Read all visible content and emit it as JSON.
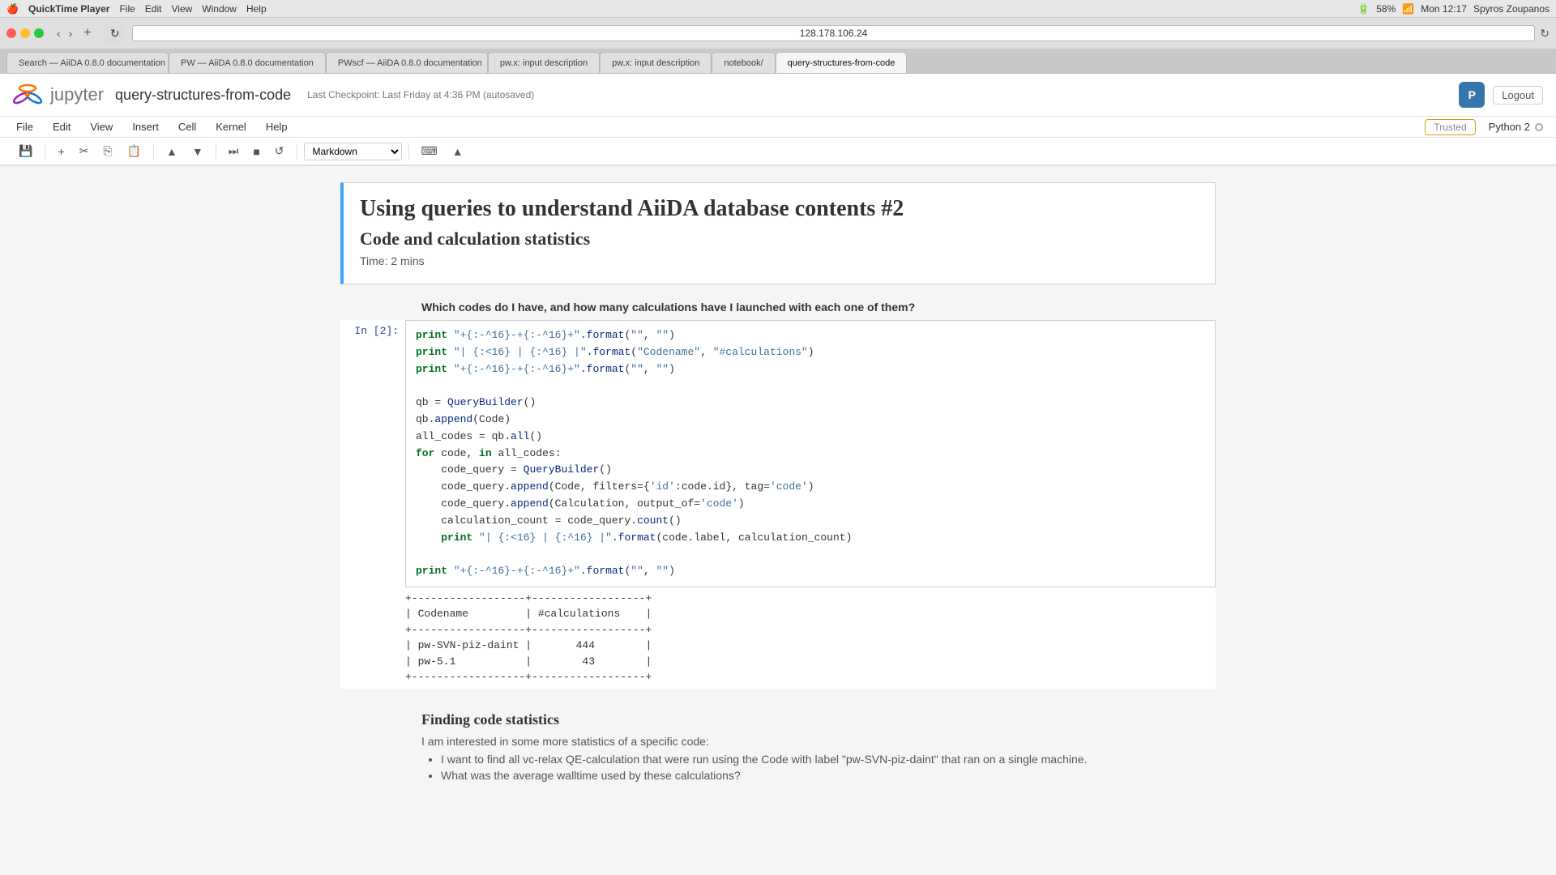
{
  "macbar": {
    "apple": "🍎",
    "app_name": "QuickTime Player",
    "menus": [
      "File",
      "Edit",
      "View",
      "Window",
      "Help"
    ],
    "time": "Mon 12:17",
    "user": "Spyros Zoupanos",
    "battery": "58%"
  },
  "browser": {
    "address": "128.178.106.24",
    "tabs": [
      {
        "id": "tab1",
        "label": "Search — AiiDA 0.8.0 documentation",
        "active": false
      },
      {
        "id": "tab2",
        "label": "PW — AiiDA 0.8.0 documentation",
        "active": false
      },
      {
        "id": "tab3",
        "label": "PWscf — AiiDA 0.8.0 documentation",
        "active": false
      },
      {
        "id": "tab4",
        "label": "pw.x: input description",
        "active": false
      },
      {
        "id": "tab5",
        "label": "pw.x: input description",
        "active": false
      },
      {
        "id": "tab6",
        "label": "notebook/",
        "active": false
      },
      {
        "id": "tab7",
        "label": "query-structures-from-code",
        "active": true
      }
    ]
  },
  "jupyter": {
    "notebook_name": "query-structures-from-code",
    "checkpoint": "Last Checkpoint: Last Friday at 4:36 PM (autosaved)",
    "logout_label": "Logout",
    "trusted_label": "Trusted",
    "kernel_name": "Python 2",
    "menus": [
      "File",
      "Edit",
      "View",
      "Insert",
      "Cell",
      "Kernel",
      "Help"
    ],
    "cell_type": "Markdown",
    "toolbar_buttons": {
      "save": "💾",
      "add": "+",
      "cut": "✂",
      "copy": "⎘",
      "paste": "📋",
      "move_up": "▲",
      "move_down": "▼",
      "step_over": "⏭",
      "stop": "■",
      "restart": "↺"
    }
  },
  "content": {
    "markdown_title": "Using queries to understand AiiDA database contents #2",
    "markdown_subtitle": "Code and calculation statistics",
    "markdown_time": "Time: 2 mins",
    "question_text": "Which codes do I have, and how many calculations have I launched with each one of them?",
    "code_cell": {
      "prompt": "In [2]:",
      "lines": [
        {
          "type": "code",
          "text": "print \"+{:-^16}-+{:-^16}+\".format(\"\", \"\")"
        },
        {
          "type": "code",
          "text": "print \"| {:&lt;16} | {:^16} |\".format(\"Codename\", \"#calculations\")"
        },
        {
          "type": "code",
          "text": "print \"+{:-^16}-+{:-^16}+\".format(\"\", \"\")"
        },
        {
          "type": "blank"
        },
        {
          "type": "code",
          "text": "qb = QueryBuilder()"
        },
        {
          "type": "code",
          "text": "qb.append(Code)"
        },
        {
          "type": "code",
          "text": "all_codes = qb.all()"
        },
        {
          "type": "code",
          "text": "for code, in all_codes:"
        },
        {
          "type": "code",
          "text": "    code_query = QueryBuilder()"
        },
        {
          "type": "code",
          "text": "    code_query.append(Code, filters={'id':code.id}, tag='code')"
        },
        {
          "type": "code",
          "text": "    code_query.append(Calculation, output_of='code')"
        },
        {
          "type": "code",
          "text": "    calculation_count = code_query.count()"
        },
        {
          "type": "code",
          "text": "    print \"| {:<16} | {:^16} |\".format(code.label, calculation_count)"
        },
        {
          "type": "blank"
        },
        {
          "type": "code",
          "text": "print \"+{:-^16}-+{:-^16}+\".format(\"\", \"\")"
        }
      ]
    },
    "output_table": "+------------------+------------------+\n| Codename         | #calculations    |\n+------------------+------------------+\n| pw-SVN-piz-daint |       444        |\n| pw-5.1           |        43        |\n+------------------+------------------+",
    "section_heading": "Finding code statistics",
    "section_intro": "I am interested in some more statistics of a specific code:",
    "bullets": [
      "I want to find all vc-relax QE-calculation that were run using the Code with label \"pw-SVN-piz-daint\" that ran on a single machine.",
      "What was the average walltime used by these calculations?"
    ]
  }
}
